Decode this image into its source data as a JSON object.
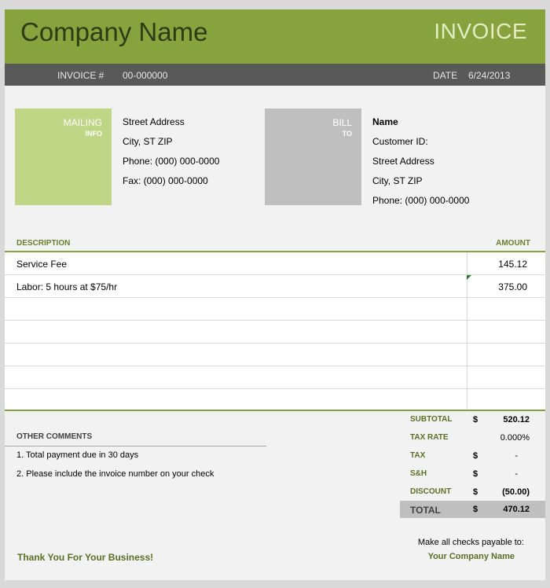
{
  "header": {
    "company": "Company Name",
    "title": "INVOICE"
  },
  "infobar": {
    "invoice_label": "INVOICE #",
    "invoice_number": "00-000000",
    "date_label": "DATE",
    "date": "6/24/2013"
  },
  "mailing": {
    "label": "MAILING",
    "sublabel": "INFO",
    "lines": [
      "Street Address",
      "City, ST  ZIP",
      "Phone: (000) 000-0000",
      "Fax: (000) 000-0000"
    ]
  },
  "billto": {
    "label": "BILL",
    "sublabel": "TO",
    "name": "Name",
    "lines": [
      "Customer ID:",
      "Street Address",
      "City, ST  ZIP",
      "Phone: (000) 000-0000"
    ]
  },
  "table": {
    "headers": {
      "description": "DESCRIPTION",
      "amount": "AMOUNT"
    },
    "rows": [
      {
        "description": "Service Fee",
        "amount": "145.12"
      },
      {
        "description": "Labor: 5 hours at $75/hr",
        "amount": "375.00"
      },
      {
        "description": "",
        "amount": ""
      },
      {
        "description": "",
        "amount": ""
      },
      {
        "description": "",
        "amount": ""
      },
      {
        "description": "",
        "amount": ""
      },
      {
        "description": "",
        "amount": ""
      }
    ]
  },
  "comments": {
    "heading": "OTHER COMMENTS",
    "items": [
      "1. Total payment due in 30 days",
      "2. Please include the invoice number on your check"
    ]
  },
  "totals": {
    "subtotal": {
      "label": "SUBTOTAL",
      "currency": "$",
      "value": "520.12"
    },
    "tax_rate": {
      "label": "TAX RATE",
      "currency": "",
      "value": "0.000%"
    },
    "tax": {
      "label": "TAX",
      "currency": "$",
      "value": "-"
    },
    "sh": {
      "label": "S&H",
      "currency": "$",
      "value": "-"
    },
    "discount": {
      "label": "DISCOUNT",
      "currency": "$",
      "value": "(50.00)"
    },
    "total": {
      "label": "TOTAL",
      "currency": "$",
      "value": "470.12"
    }
  },
  "footer": {
    "thanks": "Thank You For Your Business!",
    "payable_label": "Make all checks payable to:",
    "payable_name": "Your Company Name"
  },
  "colors": {
    "brand_green": "#86a33e",
    "dark_bar": "#595959",
    "light_green": "#bfd687",
    "gray_box": "#bfbfbf"
  }
}
